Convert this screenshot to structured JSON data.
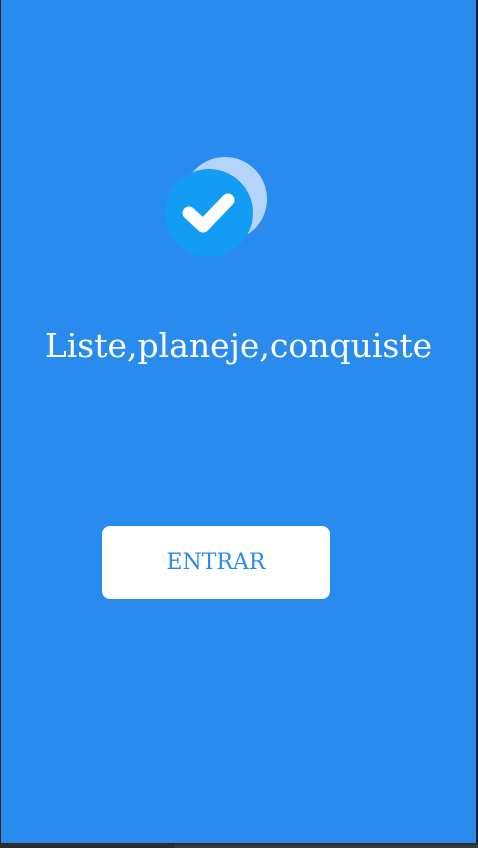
{
  "app": {
    "background_color": "#2a8bef",
    "logo_icon": "check-circle-icon",
    "tagline": "Liste,planeje,conquiste",
    "enter_button_label": "ENTRAR"
  },
  "colors": {
    "accent": "#2a8bef",
    "logo_back_circle": "#b5d4fb",
    "logo_front_circle": "#129cf3",
    "button_background": "#ffffff",
    "text": "#ffffff"
  }
}
